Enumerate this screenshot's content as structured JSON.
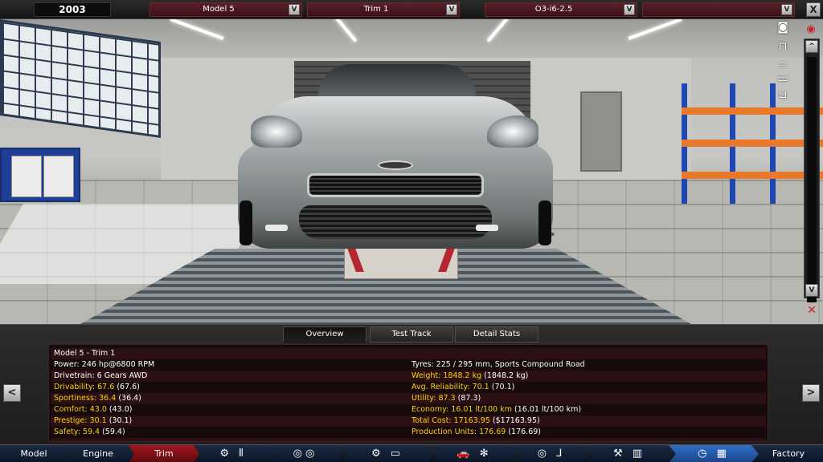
{
  "topbar": {
    "year": "2003",
    "model": "Model 5",
    "trim": "Trim 1",
    "engine": "O3-i6-2.5",
    "variant": "",
    "dropdown_button": "V",
    "close_button": "X"
  },
  "camera_controls": {
    "screenshot_icon": "camera-icon",
    "view_icon": "eye-icon",
    "car_views": [
      "car-front-icon",
      "car-side-icon",
      "car-top-icon",
      "car-rear-icon"
    ],
    "scroll_up": "^",
    "scroll_down": "V",
    "no_camera": "camera-off-icon"
  },
  "tabs": [
    {
      "label": "Overview",
      "active": true
    },
    {
      "label": "Test Track",
      "active": false
    },
    {
      "label": "Detail Stats",
      "active": false
    }
  ],
  "stats": {
    "title": "Model 5 - Trim 1",
    "left": [
      {
        "text": "Power: 246 hp@6800 RPM",
        "highlight": false
      },
      {
        "text": "Drivetrain: 6 Gears AWD",
        "highlight": false
      },
      {
        "text": "Drivability: 67.6 ",
        "sub": "(67.6)",
        "highlight": true
      },
      {
        "text": "Sportiness: 36.4 ",
        "sub": "(36.4)",
        "highlight": true
      },
      {
        "text": "Comfort: 43.0 ",
        "sub": "(43.0)",
        "highlight": true
      },
      {
        "text": "Prestige: 30.1 ",
        "sub": "(30.1)",
        "highlight": true
      },
      {
        "text": "Safety: 59.4 ",
        "sub": "(59.4)",
        "highlight": true
      }
    ],
    "right": [
      {
        "text": "Tyres: 225 / 295 mm, Sports Compound Road",
        "highlight": false
      },
      {
        "text": "Weight: 1848.2 kg ",
        "sub": "(1848.2 kg)",
        "highlight": true
      },
      {
        "text": "Avg. Reliability: 70.1 ",
        "sub": "(70.1)",
        "highlight": true
      },
      {
        "text": "Utility: 87.3 ",
        "sub": "(87.3)",
        "highlight": true
      },
      {
        "text": "Economy: 16.01 lt/100 km ",
        "sub": "(16.01 lt/100 km)",
        "highlight": true
      },
      {
        "text": "Total Cost: 17163.95 ",
        "sub": "($17163.95)",
        "highlight": true
      },
      {
        "text": "Production Units: 176.69 ",
        "sub": "(176.69)",
        "highlight": true
      }
    ]
  },
  "side_arrows": {
    "prev": "<",
    "next": ">"
  },
  "nav": [
    {
      "label": "Model",
      "state": "normal"
    },
    {
      "label": "Engine",
      "state": "normal"
    },
    {
      "label": "Trim",
      "state": "active"
    },
    {
      "label": "",
      "icons": "⚙ ⫴",
      "name": "chassis-gearbox",
      "state": "icon"
    },
    {
      "label": "",
      "icons": "◎◎",
      "name": "wheels",
      "state": "icon"
    },
    {
      "label": "",
      "icons": "⚙ ▭",
      "name": "body",
      "state": "icon"
    },
    {
      "label": "",
      "icons": "🚗 ✻",
      "name": "body-fan",
      "state": "icon"
    },
    {
      "label": "",
      "icons": "◎ ⅃",
      "name": "interior",
      "state": "icon"
    },
    {
      "label": "",
      "icons": "⚒ ▥",
      "name": "suspension",
      "state": "icon"
    },
    {
      "label": "",
      "icons": "◷ ▦",
      "name": "test-flag",
      "state": "iconhl"
    },
    {
      "label": "Factory",
      "state": "normal"
    }
  ]
}
